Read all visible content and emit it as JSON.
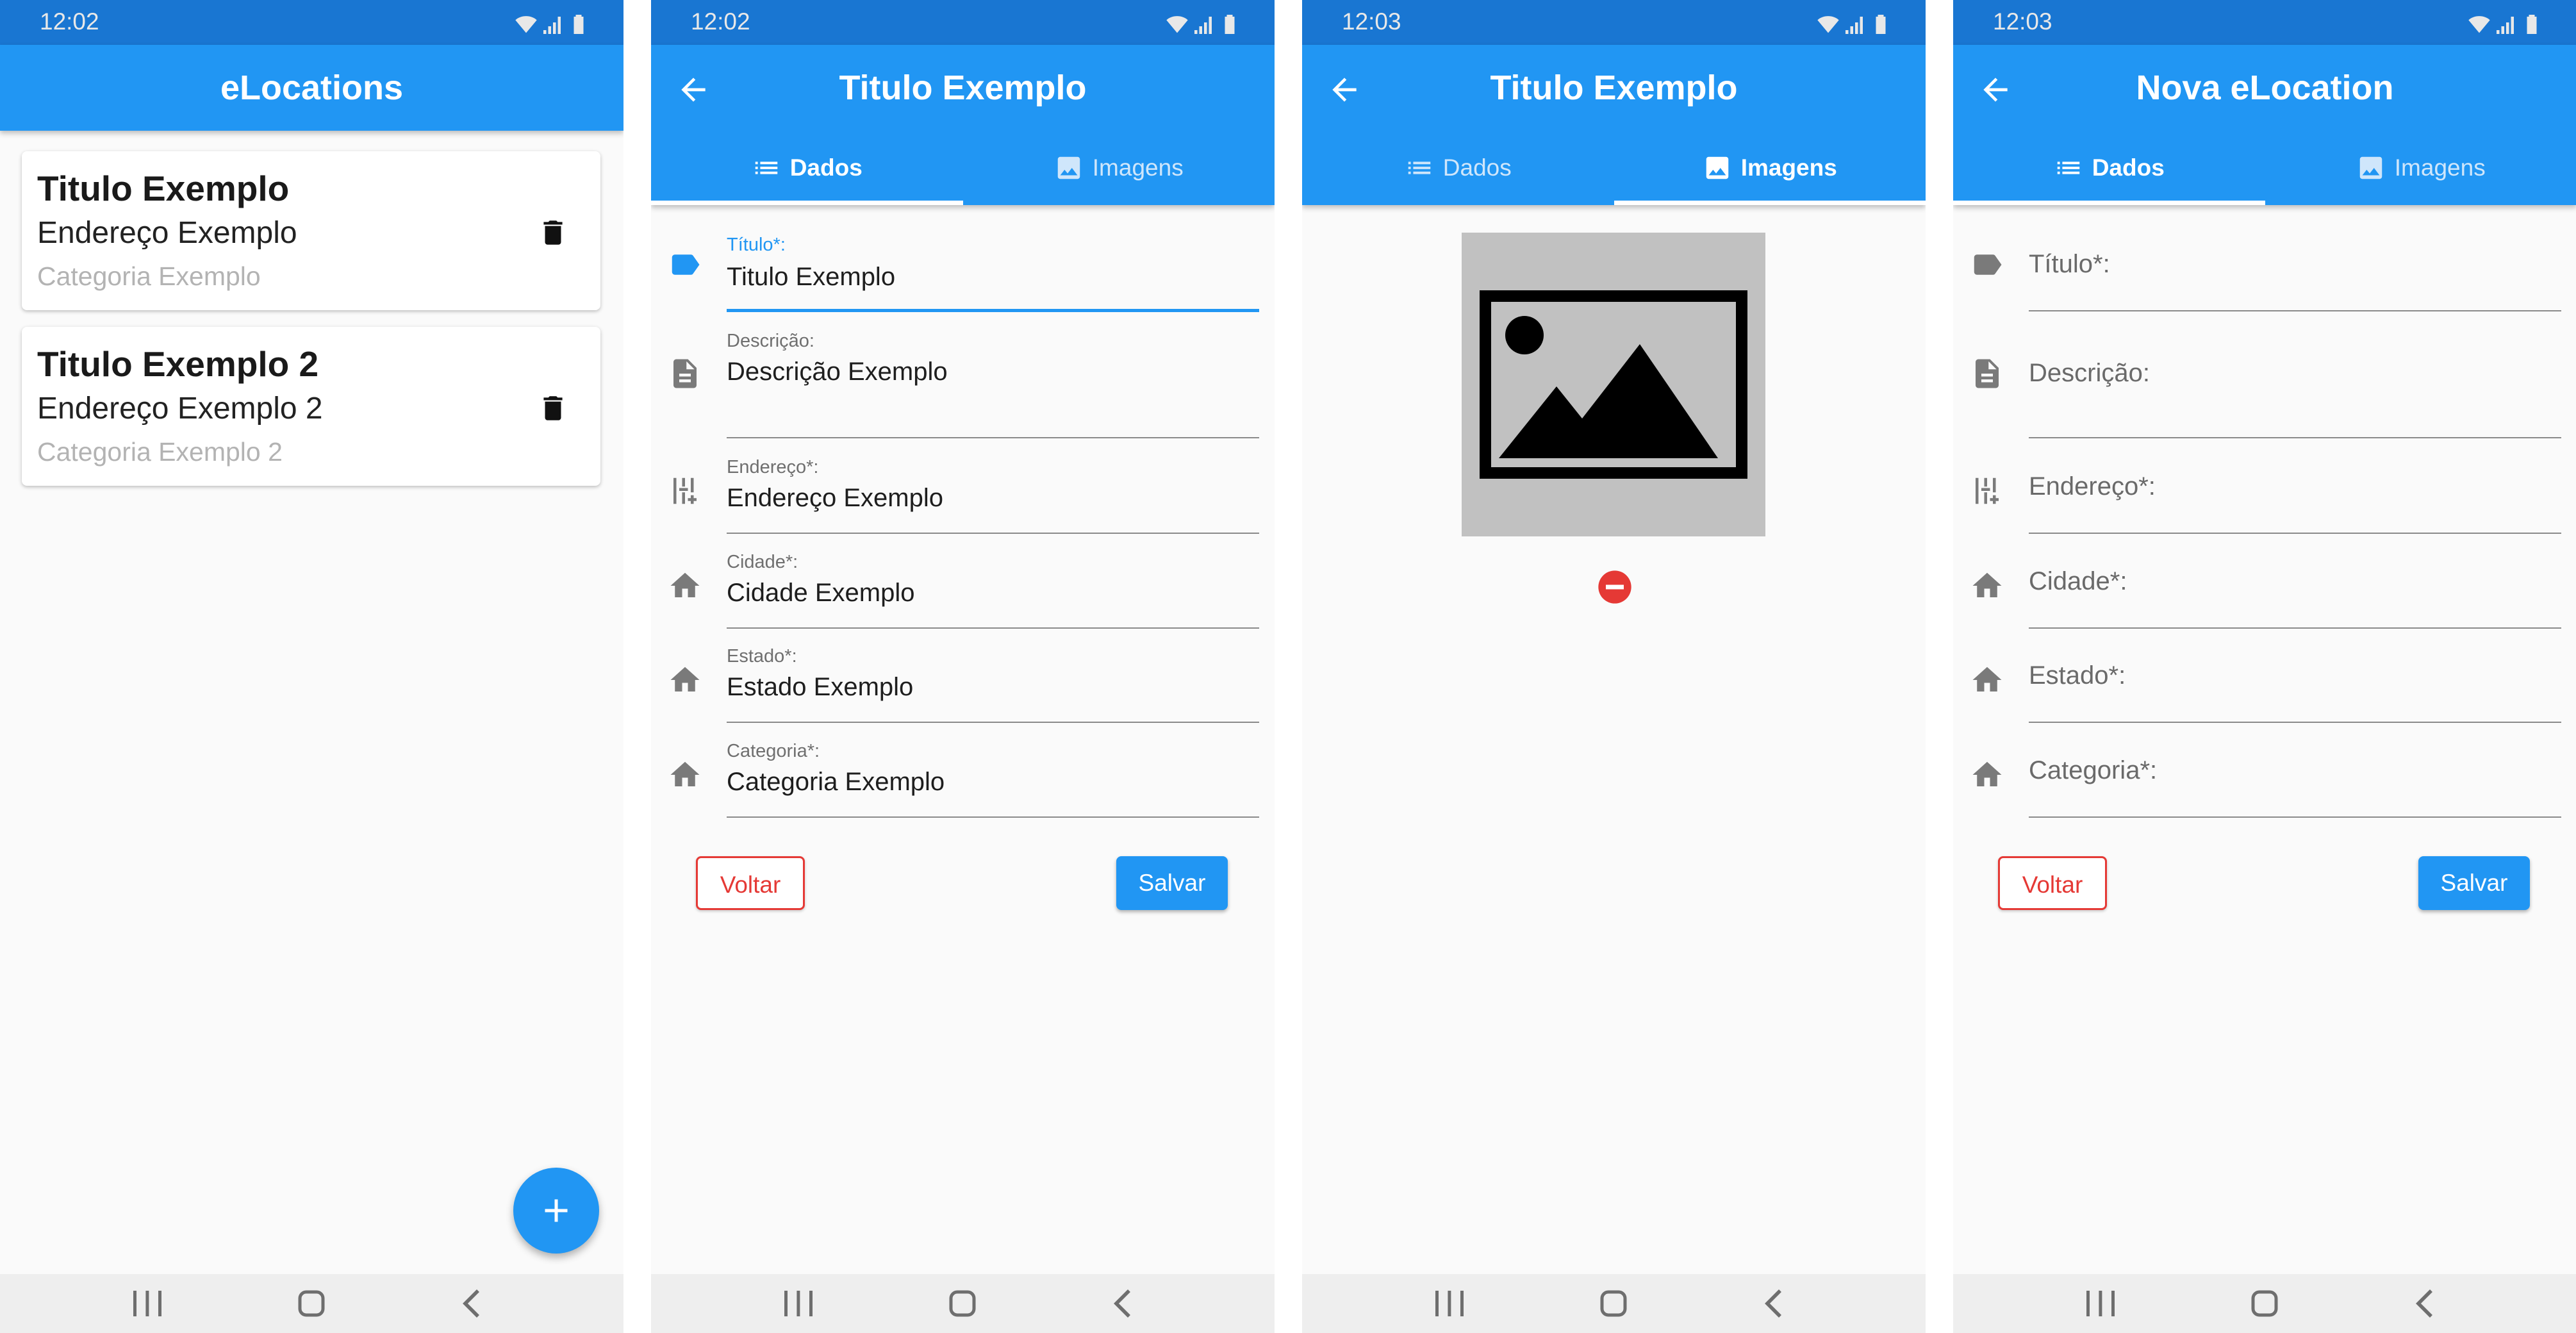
{
  "colors": {
    "primary": "#2196f3",
    "status_bar": "#1976d2",
    "danger": "#e53935",
    "background": "#fafafa"
  },
  "screen1": {
    "status_time": "12:02",
    "title": "eLocations",
    "items": [
      {
        "title": "Titulo Exemplo",
        "address": "Endereço Exemplo",
        "category": "Categoria Exemplo"
      },
      {
        "title": "Titulo Exemplo 2",
        "address": "Endereço Exemplo 2",
        "category": "Categoria Exemplo 2"
      }
    ],
    "fab_icon": "plus-icon"
  },
  "screen2": {
    "status_time": "12:02",
    "title": "Titulo Exemplo",
    "tabs": [
      "Dados",
      "Imagens"
    ],
    "active_tab": "Dados",
    "fields": [
      {
        "label": "Título*:",
        "value": "Titulo Exemplo",
        "icon": "label-icon"
      },
      {
        "label": "Descrição:",
        "value": "Descrição Exemplo",
        "icon": "description-icon"
      },
      {
        "label": "Endereço*:",
        "value": "Endereço Exemplo",
        "icon": "address-icon"
      },
      {
        "label": "Cidade*:",
        "value": "Cidade Exemplo",
        "icon": "home-icon"
      },
      {
        "label": "Estado*:",
        "value": "Estado Exemplo",
        "icon": "home-icon"
      },
      {
        "label": "Categoria*:",
        "value": "Categoria Exemplo",
        "icon": "home-icon"
      }
    ],
    "back_button": "Voltar",
    "save_button": "Salvar"
  },
  "screen3": {
    "status_time": "12:03",
    "title": "Titulo Exemplo",
    "tabs": [
      "Dados",
      "Imagens"
    ],
    "active_tab": "Imagens",
    "image_icon": "image-placeholder-icon",
    "remove_icon": "remove-circle-icon"
  },
  "screen4": {
    "status_time": "12:03",
    "title": "Nova eLocation",
    "tabs": [
      "Dados",
      "Imagens"
    ],
    "active_tab": "Dados",
    "fields": [
      {
        "label": "Título*:",
        "icon": "label-icon"
      },
      {
        "label": "Descrição:",
        "icon": "description-icon"
      },
      {
        "label": "Endereço*:",
        "icon": "address-icon"
      },
      {
        "label": "Cidade*:",
        "icon": "home-icon"
      },
      {
        "label": "Estado*:",
        "icon": "home-icon"
      },
      {
        "label": "Categoria*:",
        "icon": "home-icon"
      }
    ],
    "back_button": "Voltar",
    "save_button": "Salvar"
  }
}
